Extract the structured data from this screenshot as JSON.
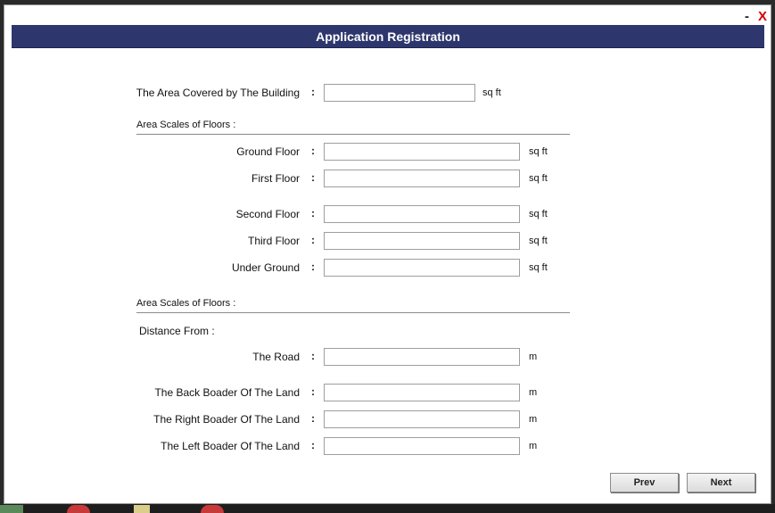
{
  "window": {
    "title": "Application Registration",
    "minimize_label": "-",
    "close_label": "X"
  },
  "building_area": {
    "label": "The Area Covered by The Building",
    "colon": ":",
    "value": "",
    "unit": "sq ft"
  },
  "floors_section": {
    "title": "Area Scales of Floors :",
    "rows": [
      {
        "label": "Ground Floor",
        "colon": ":",
        "value": "",
        "unit": "sq ft"
      },
      {
        "label": "First Floor",
        "colon": ":",
        "value": "",
        "unit": "sq ft"
      },
      {
        "label": "Second Floor",
        "colon": ":",
        "value": "",
        "unit": "sq ft"
      },
      {
        "label": "Third Floor",
        "colon": ":",
        "value": "",
        "unit": "sq ft"
      },
      {
        "label": "Under Ground",
        "colon": ":",
        "value": "",
        "unit": "sq ft"
      }
    ]
  },
  "distance_section": {
    "title": "Area Scales of Floors :",
    "subhead": "Distance From :",
    "rows": [
      {
        "label": "The Road",
        "colon": ":",
        "value": "",
        "unit": "m"
      },
      {
        "label": "The Back Boader Of The Land",
        "colon": ":",
        "value": "",
        "unit": "m"
      },
      {
        "label": "The Right Boader Of The Land",
        "colon": ":",
        "value": "",
        "unit": "m"
      },
      {
        "label": "The Left Boader Of The Land",
        "colon": ":",
        "value": "",
        "unit": "m"
      }
    ]
  },
  "buttons": {
    "prev_label": "Prev",
    "next_label": "Next"
  },
  "colors": {
    "header_bg": "#2e376d",
    "close_red": "#d40000"
  }
}
